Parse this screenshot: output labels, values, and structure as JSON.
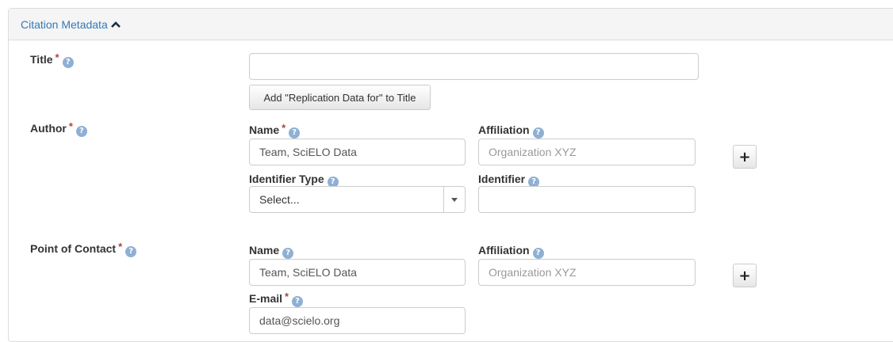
{
  "panel": {
    "heading": "Citation Metadata",
    "heading_icon": "chevron-up-icon"
  },
  "title_field": {
    "label": "Title",
    "required_mark": "*",
    "value": "",
    "add_button": "Add \"Replication Data for\" to Title"
  },
  "author": {
    "label": "Author",
    "required_mark": "*",
    "name_label": "Name",
    "name_required": "*",
    "name_value": "Team, SciELO Data",
    "affiliation_label": "Affiliation",
    "affiliation_placeholder": "Organization XYZ",
    "identifier_type_label": "Identifier Type",
    "identifier_type_value": "Select...",
    "identifier_label": "Identifier",
    "identifier_value": "",
    "add_symbol": "+"
  },
  "contact": {
    "label": "Point of Contact",
    "required_mark": "*",
    "name_label": "Name",
    "name_value": "Team, SciELO Data",
    "affiliation_label": "Affiliation",
    "affiliation_placeholder": "Organization XYZ",
    "email_label": "E-mail",
    "email_required": "*",
    "email_value": "data@scielo.org",
    "add_symbol": "+"
  },
  "help_glyph": "?",
  "colors": {
    "link": "#337ab7",
    "required": "#a94442",
    "help": "#8fb0d4"
  }
}
